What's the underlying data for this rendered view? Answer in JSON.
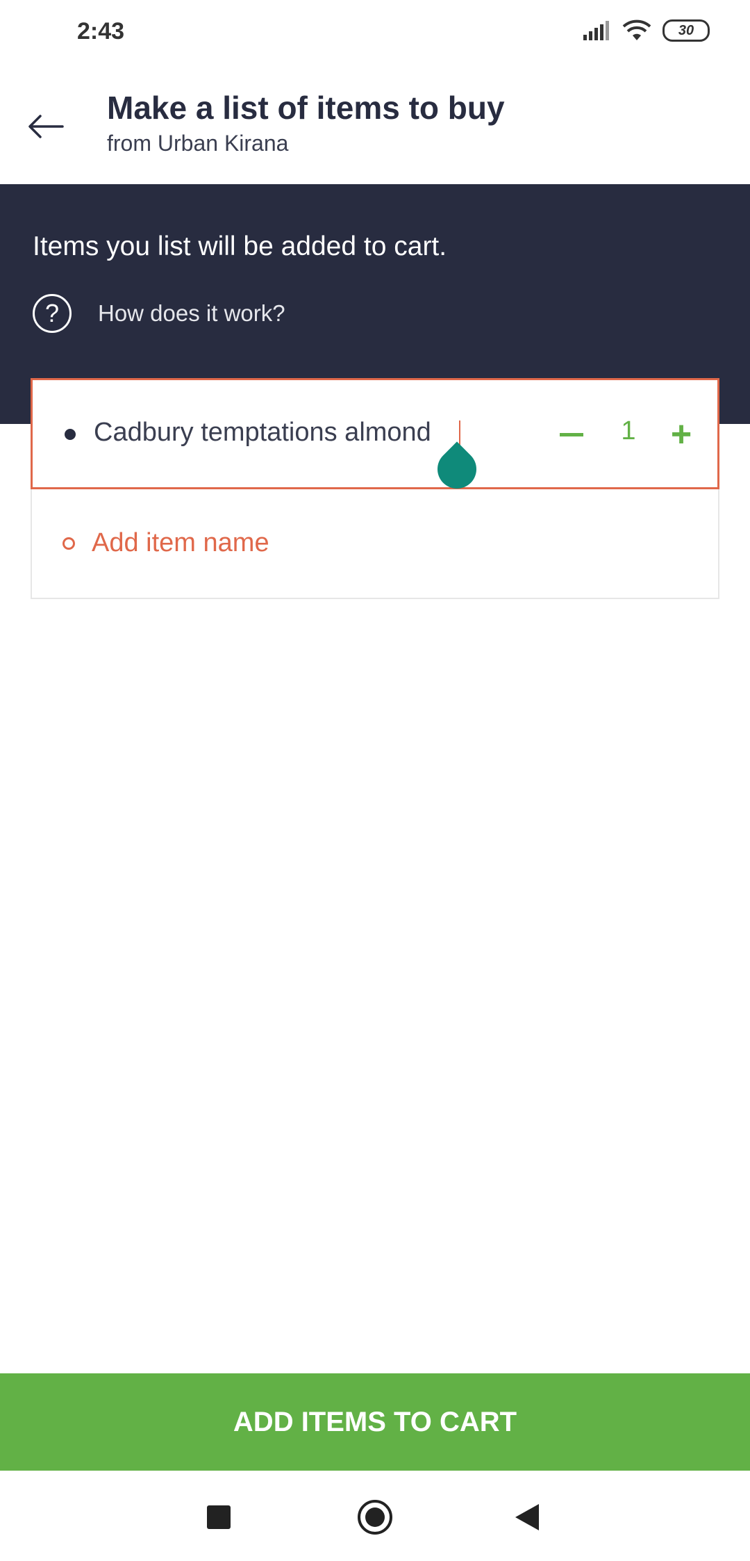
{
  "status_bar": {
    "time": "2:43",
    "battery": "30",
    "icons": [
      "signal-icon",
      "wifi-icon",
      "battery-icon"
    ]
  },
  "header": {
    "title": "Make a list of items to buy",
    "subtitle": "from Urban Kirana",
    "back_icon": "back-arrow-icon"
  },
  "banner": {
    "message": "Items you list will be added to cart.",
    "how_label": "How does it work?",
    "help_icon_glyph": "?"
  },
  "list": {
    "items": [
      {
        "name": "Cadbury temptations almond",
        "quantity": "1"
      }
    ],
    "add_placeholder": "Add item name"
  },
  "cta": {
    "label": "ADD ITEMS TO CART"
  },
  "colors": {
    "dark_navy": "#282c40",
    "accent_orange": "#e0684a",
    "green": "#62b146",
    "teal_handle": "#0f8a7a"
  }
}
